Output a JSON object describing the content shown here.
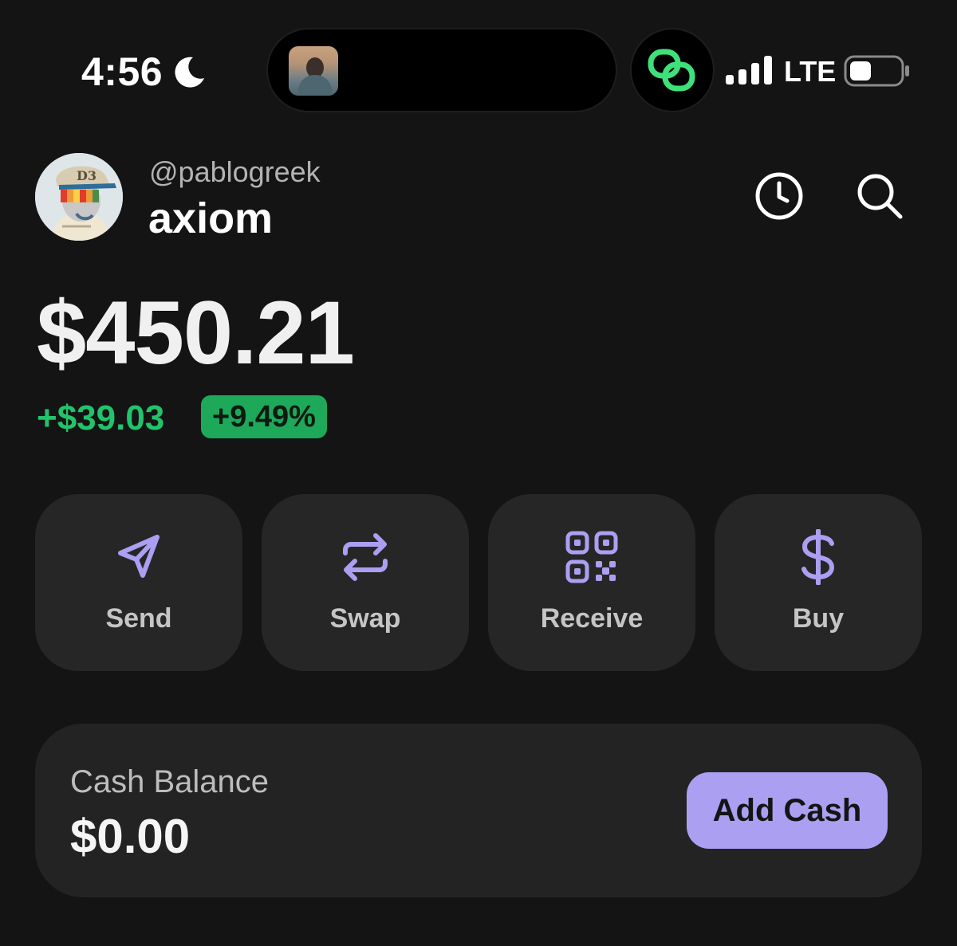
{
  "status_bar": {
    "time": "4:56",
    "network": "LTE",
    "icons": [
      "moon-icon",
      "live-activity-thumbnail",
      "link-app-icon",
      "signal-icon",
      "battery-icon"
    ]
  },
  "header": {
    "handle": "@pablogreek",
    "wallet_name": "axiom",
    "icons": [
      "history-icon",
      "search-icon"
    ]
  },
  "balance": {
    "total": "$450.21",
    "change_amount": "+$39.03",
    "change_percent": "+9.49%"
  },
  "actions": [
    {
      "label": "Send",
      "icon": "send-icon"
    },
    {
      "label": "Swap",
      "icon": "swap-icon"
    },
    {
      "label": "Receive",
      "icon": "qr-code-icon"
    },
    {
      "label": "Buy",
      "icon": "dollar-icon"
    }
  ],
  "cash_card": {
    "label": "Cash Balance",
    "value": "$0.00",
    "button_label": "Add Cash"
  },
  "colors": {
    "background": "#141414",
    "card": "#262626",
    "accent_purple": "#ab9ff2",
    "positive_green": "#22c36b",
    "badge_green": "#1ea85a",
    "link_green": "#3ee07a"
  }
}
